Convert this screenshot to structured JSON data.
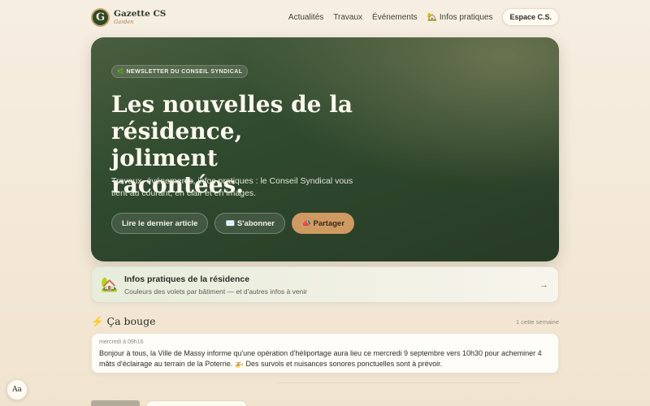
{
  "brand": {
    "mark": "G",
    "name": "Gazette CS",
    "sub": "Garden"
  },
  "nav": {
    "links": [
      "Actualités",
      "Travaux",
      "Événements",
      "🏡 Infos pratiques"
    ],
    "cta": "Espace C.S."
  },
  "hero": {
    "pill": "🌿 NEWSLETTER DU CONSEIL SYNDICAL",
    "title": "Les nouvelles de la résidence, joliment racontées.",
    "subtitle": "Travaux, événements, infos pratiques : le Conseil Syndical vous tient au courant, en clair et en images.",
    "buttons": {
      "read": "Lire le dernier article",
      "subscribe": "✉️ S'abonner",
      "share": "📣 Partager"
    }
  },
  "info_card": {
    "icon": "🏡",
    "title": "Infos pratiques de la résidence",
    "description": "Couleurs des volets par bâtiment — et d'autres infos à venir",
    "arrow": "→"
  },
  "activity": {
    "title": "⚡ Ça bouge",
    "count": "1 cette semaine",
    "post": {
      "time": "mercredi à 09h16",
      "text": "Bonjour à tous, la Ville de Massy informe qu'une opération d'héliportage aura lieu ce mercredi 9 septembre vers 10h30 pour acheminer 4 mâts d'éclairage au terrain de la Poterne. 🚁 Des survols et nuisances sonores ponctuelles sont à prévoir."
    }
  },
  "font_toggle": "Aa",
  "colors": {
    "hero": "#2f4a2f",
    "accent": "#cf9a62",
    "background": "#f6eee2"
  }
}
